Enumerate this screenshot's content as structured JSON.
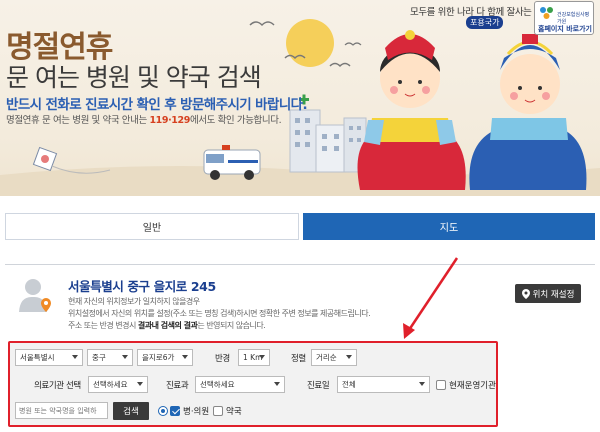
{
  "banner": {
    "title_line1": "명절연휴",
    "title_line2": "문 여는 병원 및 약국 검색",
    "subtitle": "반드시 전화로 진료시간 확인 후 방문해주시기 바랍니다.",
    "info_prefix": "명절연휴 문 여는 병원 및 약국 안내는 ",
    "info_numbers": "119·129",
    "info_suffix": "에서도 확인 가능합니다.",
    "topright_text": "모두를 위한 나라 다 함께 잘사는",
    "pogo_badge": "포용국가",
    "logo_text": "홈페이지 바로가기",
    "logo_small": "건강보험심사평가원"
  },
  "tabs": [
    {
      "label": "일반",
      "active": false
    },
    {
      "label": "지도",
      "active": true
    }
  ],
  "location": {
    "address": "서울특별시 중구 을지로 245",
    "note_line1": "현재 자신의 위치정보가 일치하지 않을경우",
    "note_line2": "위치설정에서 자신의 위치를 설정(주소 또는 명칭 검색)하시면 정확한 주변 정보를 제공해드립니다.",
    "note_line3_prefix": "주소 또는 반경 변경시 ",
    "note_line3_bold": "결과내 검색의 결과",
    "note_line3_suffix": "는 반영되지 않습니다.",
    "reset_button": "위치 재설정"
  },
  "filters": {
    "sido": "서울특별시",
    "sigungu": "중구",
    "dong": "을지로6가",
    "radius_label": "반경",
    "radius_value": "1 Km",
    "sort_label": "정렬",
    "sort_value": "거리순",
    "inst_label": "의료기관 선택",
    "inst_value": "선택하세요",
    "dept_label": "진료과",
    "dept_value": "선택하세요",
    "day_label": "진료일",
    "day_value": "전체",
    "operating_label": "현재운영기관",
    "search_placeholder": "병원 또는 약국명을 입력하",
    "search_button": "검색",
    "opt_hospital": "병·의원",
    "opt_pharmacy": "약국"
  },
  "colors": {
    "accent_blue": "#1f66b5",
    "highlight_red": "#e0202b",
    "title_brown": "#8a5a2e"
  }
}
